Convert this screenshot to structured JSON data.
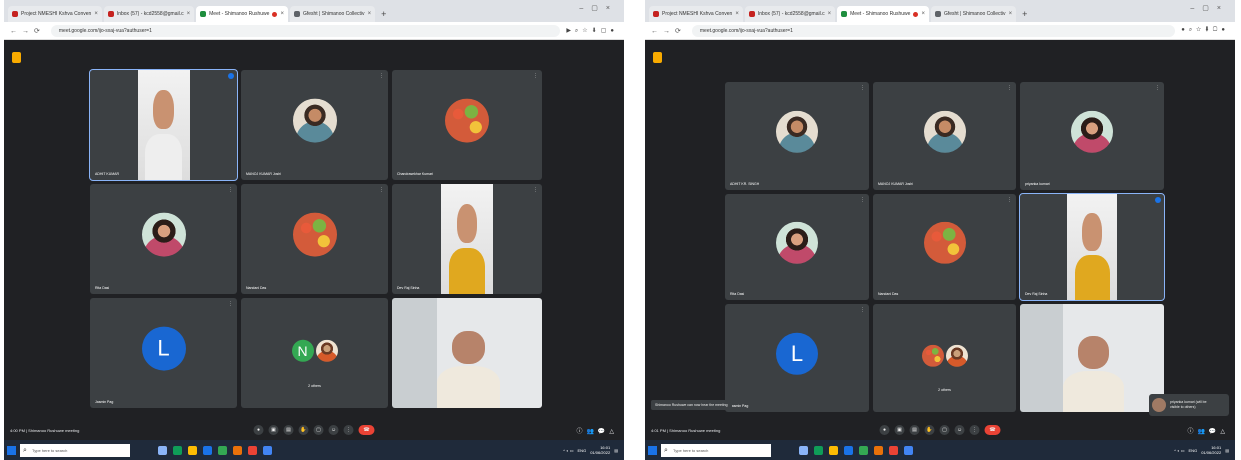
{
  "screens": [
    {
      "tabs": [
        {
          "label": "Project NMESHI Kshva Conven",
          "fav": "#c5221f",
          "active": false
        },
        {
          "label": "Inbox (57) - kcd2558@gmail.c",
          "fav": "#c5221f",
          "active": false
        },
        {
          "label": "Meet - Shimanoo Rushuwe",
          "fav": "#1e8e3e",
          "active": true,
          "recording": true
        },
        {
          "label": "Gfesht | Shimanoo Collectiv",
          "fav": "#5f6368",
          "active": false
        }
      ],
      "url": "meet.google.com/ijo-sxaj-vua?authuser=1",
      "participants": [
        {
          "name": "ADHIT KUMAR"
        },
        {
          "name": "MANOJ KUMAR Joshi"
        },
        {
          "name": "Chandrasekhar Kumari"
        },
        {
          "name": "Rita Dasi"
        },
        {
          "name": "Nandani Das"
        },
        {
          "name": "Dev Raj Sinha"
        },
        {
          "name": "Jasmin Pag",
          "initial": "L",
          "color": "#1967d2"
        },
        {
          "name": "2 others",
          "initial": "N",
          "color": "#34a853"
        },
        {
          "name": ""
        }
      ],
      "meeting": {
        "time": "4:00 PM",
        "title": "Shimanoo Rushuwe meeting"
      },
      "taskbar": {
        "search_placeholder": "Type here to search",
        "time": "16:01",
        "date": "01/06/2022",
        "lang": "ENG"
      }
    },
    {
      "tabs": [
        {
          "label": "Project NMESHI Kshva Conven",
          "fav": "#c5221f",
          "active": false
        },
        {
          "label": "Inbox (57) - kcd2558@gmail.c",
          "fav": "#c5221f",
          "active": false
        },
        {
          "label": "Meet - Shimanoo Rushuwe",
          "fav": "#1e8e3e",
          "active": true,
          "recording": true
        },
        {
          "label": "Gfesht | Shimanoo Collectiv",
          "fav": "#5f6368",
          "active": false
        }
      ],
      "url": "meet.google.com/ijo-sxaj-vua?authuser=1",
      "participants": [
        {
          "name": "ADHIT KR. SINGH"
        },
        {
          "name": "MANOJ KUMAR Joshi"
        },
        {
          "name": "priyanka kumari"
        },
        {
          "name": "Rita Dasi"
        },
        {
          "name": "Nandani Das"
        },
        {
          "name": "Dev Raj Sinha"
        },
        {
          "name": "Jasmin Pag",
          "initial": "L",
          "color": "#1967d2"
        },
        {
          "name": "2 others"
        },
        {
          "name": ""
        }
      ],
      "snackbar": "Shimanoo Rushuwe can now hear the meeting",
      "presenter": {
        "name": "priyanka kumari (will be",
        "detail": "visible to others)"
      },
      "meeting": {
        "time": "4:01 PM",
        "title": "Shimanoo Rushuwe meeting"
      },
      "taskbar": {
        "search_placeholder": "Type here to search",
        "time": "16:01",
        "date": "01/06/2022",
        "lang": "ENG"
      }
    }
  ]
}
